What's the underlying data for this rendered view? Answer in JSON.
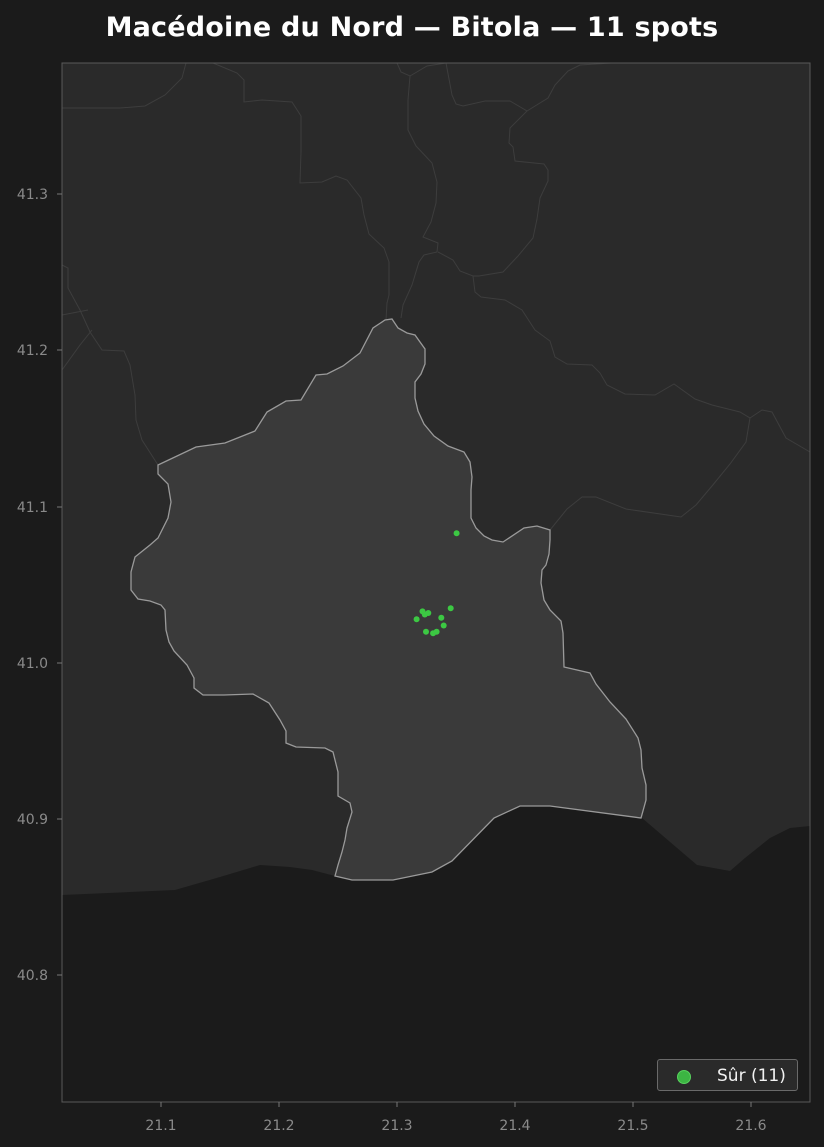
{
  "title": "Macédoine du Nord — Bitola — 11 spots",
  "colors": {
    "background": "#1b1b1b",
    "land_other": "#2a2a2a",
    "region_highlight": "#3a3a3a",
    "region_border": "#9a9a9a",
    "other_border": "#3b3b3b",
    "spot": "#3cc843"
  },
  "axes": {
    "x_ticks": [
      "21.1",
      "21.2",
      "21.3",
      "21.4",
      "21.5",
      "21.6"
    ],
    "y_ticks": [
      "41.3",
      "41.2",
      "41.1",
      "41.0",
      "40.9",
      "40.8"
    ],
    "x_range": [
      21.015,
      21.65
    ],
    "y_range": [
      40.719,
      41.384
    ]
  },
  "legend": {
    "label": "Sûr (11)",
    "marker_color": "#3cb543"
  },
  "spots": [
    {
      "lon": 21.35,
      "lat": 41.083
    },
    {
      "lon": 21.345,
      "lat": 41.035
    },
    {
      "lon": 21.321,
      "lat": 41.033
    },
    {
      "lon": 21.323,
      "lat": 41.031
    },
    {
      "lon": 21.326,
      "lat": 41.032
    },
    {
      "lon": 21.316,
      "lat": 41.028
    },
    {
      "lon": 21.337,
      "lat": 41.029
    },
    {
      "lon": 21.339,
      "lat": 41.024
    },
    {
      "lon": 21.324,
      "lat": 41.02
    },
    {
      "lon": 21.33,
      "lat": 41.019
    },
    {
      "lon": 21.333,
      "lat": 41.02
    }
  ]
}
